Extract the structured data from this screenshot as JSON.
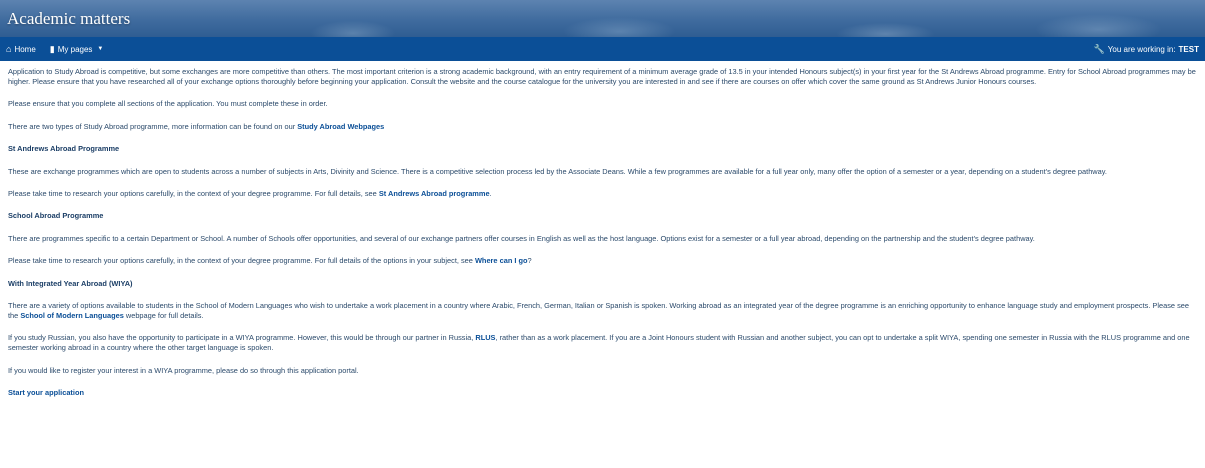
{
  "banner": {
    "title": "Academic matters"
  },
  "nav": {
    "home": "Home",
    "my_pages": "My pages",
    "working_prefix": "You are working in:",
    "working_value": "TEST"
  },
  "content": {
    "intro": "Application to Study Abroad is competitive, but some exchanges are more competitive than others. The most important criterion is a strong academic background, with an entry requirement of a minimum average grade of 13.5 in your intended Honours subject(s) in your first year for the St Andrews Abroad programme. Entry for School Abroad programmes may be higher. Please ensure that you have researched all of your exchange options thoroughly before beginning your application. Consult the website and the course catalogue for the university you are interested in and see if there are courses on offer which cover the same ground as St Andrews Junior Honours courses.",
    "complete_sections": "Please ensure that you complete all sections of the application. You must complete these in order.",
    "two_types_prefix": "There are two types of Study Abroad programme, more information can be found on our ",
    "two_types_link": "Study Abroad Webpages",
    "sa_heading": "St Andrews Abroad Programme",
    "sa_text": "These are exchange programmes which are open to students across a number of subjects in Arts, Divinity and Science. There is a competitive selection process led by the Associate Deans. While a few programmes are available for a full year only, many offer the option of a semester or a year, depending on a student's degree pathway.",
    "sa_research_prefix": "Please take time to research your options carefully, in the context of your degree programme. For full details, see ",
    "sa_research_link": "St Andrews Abroad programme",
    "sa_research_suffix": ".",
    "school_heading": "School Abroad Programme",
    "school_text": "There are programmes specific to a certain Department or School. A number of Schools offer opportunities, and several of our exchange partners offer courses in English as well as the host language. Options exist for a semester or a full year abroad, depending on the partnership and the student's degree pathway.",
    "school_research_prefix": "Please take time to research your options carefully, in the context of your degree programme. For full details of the options in your subject, see ",
    "school_research_link": "Where can I go",
    "school_research_suffix": "?",
    "wiya_heading": "With Integrated Year Abroad (WIYA)",
    "wiya_text_prefix": "There are a variety of options available to students in the School of Modern Languages who wish to undertake a work placement in a country where Arabic, French, German, Italian or Spanish is spoken. Working abroad as an integrated year of the degree programme is an enriching opportunity to enhance language study and employment prospects. Please see the ",
    "wiya_link": "School of Modern Languages",
    "wiya_text_suffix": " webpage for full details.",
    "russian_prefix": "If you study Russian, you also have the opportunity to participate in a WIYA programme. However, this would be through our partner in Russia, ",
    "russian_link": "RLUS",
    "russian_suffix": ", rather than as a work placement. If you are a Joint Honours student with Russian and another subject, you can opt to undertake a split WIYA, spending one semester in Russia with the RLUS programme and one semester working abroad in a country where the other target language is spoken.",
    "register_interest": "If you would like to register your interest in a WIYA programme, please do so through this application portal.",
    "start_link": "Start your application"
  },
  "colors": {
    "navbar": "#0b4f97",
    "link": "#0b4f97",
    "text": "#2b4a6b"
  }
}
